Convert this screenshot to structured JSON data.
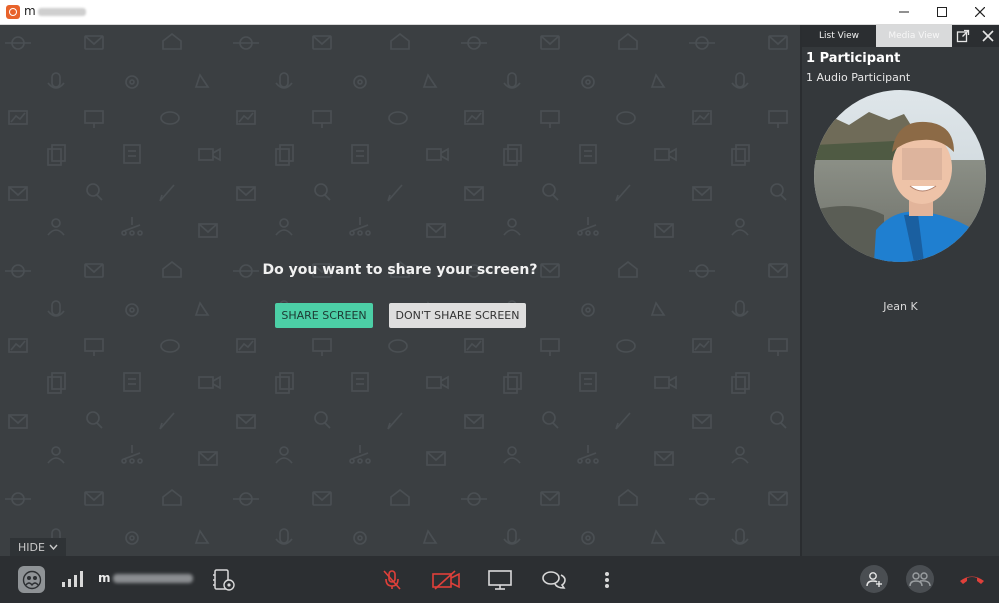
{
  "window": {
    "title_prefix": "m",
    "controls": [
      "minimize-icon",
      "maximize-icon",
      "close-icon"
    ]
  },
  "stage": {
    "prompt": "Do you want to share your screen?",
    "share_label": "SHARE SCREEN",
    "no_share_label": "DON'T SHARE SCREEN",
    "hide_label": "HIDE"
  },
  "panel": {
    "tabs": [
      {
        "label": "List View"
      },
      {
        "label": "Media View"
      }
    ],
    "participant_count": "1 Participant",
    "audio_count": "1 Audio Participant",
    "participant_name": "Jean K"
  },
  "toolbar": {
    "meeting_name_prefix": "m",
    "icons": [
      "participants-icon",
      "signal-strength-icon",
      "phone-settings-icon",
      "microphone-muted-icon",
      "camera-off-icon",
      "screen-share-icon",
      "chat-icon",
      "more-options-icon",
      "add-participant-icon",
      "group-icon",
      "hang-up-icon"
    ]
  },
  "colors": {
    "accent_green": "#4ccfa6",
    "danger_red": "#e0403a",
    "background": "#3b3f42"
  }
}
